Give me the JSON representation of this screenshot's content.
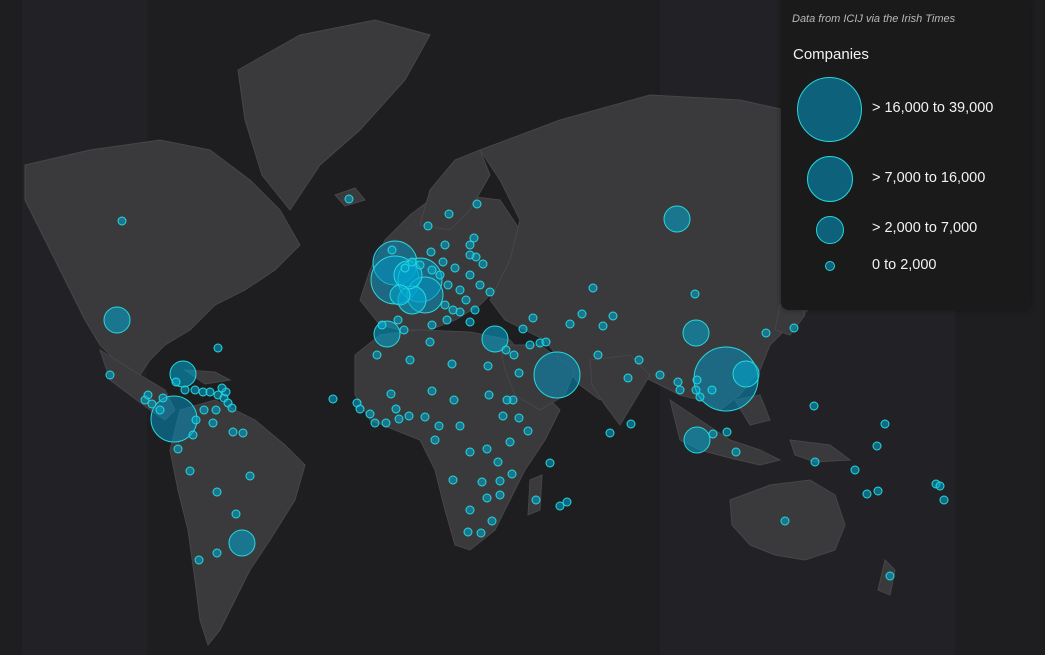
{
  "legend": {
    "credit": "Data from ICIJ via the Irish Times",
    "title": "Companies",
    "items": [
      {
        "label": "> 16,000 to 39,000"
      },
      {
        "label": "> 7,000 to 16,000"
      },
      {
        "label": "> 2,000 to 7,000"
      },
      {
        "label": "0 to 2,000"
      }
    ]
  },
  "colors": {
    "background": "#1e1e21",
    "land": "#3a3a3c",
    "bubble_fill": "#0aa5cf",
    "bubble_stroke": "#28d9dc"
  }
}
